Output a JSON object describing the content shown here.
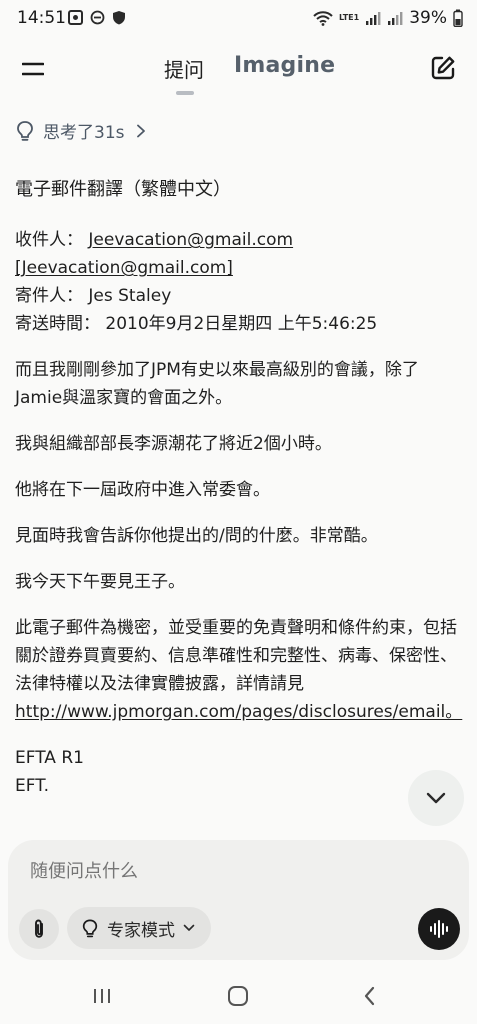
{
  "status_bar": {
    "time": "14:51",
    "battery": "39%",
    "network_label": "LTE1"
  },
  "header": {
    "tab_ask": "提问",
    "tab_imagine": "Imagine"
  },
  "thinking": {
    "label": "思考了31s"
  },
  "message": {
    "title": "電子郵件翻譯（繁體中文）",
    "to_label": "收件人：",
    "to_email": "Jeevacation@gmail.com",
    "to_email_bracketed": "[Jeevacation@gmail.com]",
    "from_label": "寄件人：",
    "from_name": "Jes Staley",
    "sent_label": "寄送時間：",
    "sent_value": "2010年9月2日星期四 上午5:46:25",
    "para1": "而且我剛剛參加了JPM有史以來最高級別的會議，除了Jamie與溫家寶的會面之外。",
    "para2": "我與組織部部長李源潮花了將近2個小時。",
    "para3": "他將在下一屆政府中進入常委會。",
    "para4": "見面時我會告訴你他提出的/問的什麼。非常酷。",
    "para5": "我今天下午要見王子。",
    "disclaimer": "此電子郵件為機密，並受重要的免責聲明和條件約束，包括關於證券買賣要約、信息準確性和完整性、病毒、保密性、法律特權以及法律實體披露，詳情請見",
    "disclaimer_link": "http://www.jpmorgan.com/pages/disclosures/email。",
    "footer_line1": "EFTA R1",
    "footer_line2": "EFT."
  },
  "composer": {
    "placeholder": "随便问点什么",
    "mode_label": "专家模式"
  },
  "icons": {
    "menu": "menu-icon",
    "compose": "edit-icon",
    "thinking": "lightbulb-icon",
    "scroll_down": "chevron-down-icon",
    "attach": "paperclip-icon",
    "mode": "lightbulb-icon",
    "voice": "waveform-icon",
    "nav_recent": "recent-apps-icon",
    "nav_home": "home-icon",
    "nav_back": "back-icon"
  },
  "colors": {
    "background": "#fafaf9",
    "composer_bg": "#f0f0ee",
    "accent_dark": "#1a1a1a",
    "muted_text": "#4d5866"
  }
}
